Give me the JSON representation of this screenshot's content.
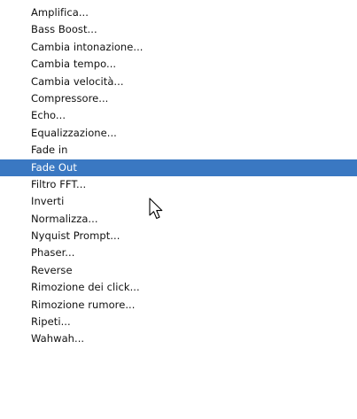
{
  "menu": {
    "items": [
      {
        "label": "Amplifica..."
      },
      {
        "label": "Bass Boost..."
      },
      {
        "label": "Cambia intonazione..."
      },
      {
        "label": "Cambia tempo..."
      },
      {
        "label": "Cambia velocità..."
      },
      {
        "label": "Compressore..."
      },
      {
        "label": "Echo..."
      },
      {
        "label": "Equalizzazione..."
      },
      {
        "label": "Fade in"
      },
      {
        "label": "Fade Out",
        "selected": true
      },
      {
        "label": "Filtro FFT..."
      },
      {
        "label": "Inverti"
      },
      {
        "label": "Normalizza..."
      },
      {
        "label": "Nyquist Prompt..."
      },
      {
        "label": "Phaser..."
      },
      {
        "label": "Reverse"
      },
      {
        "label": "Rimozione dei click..."
      },
      {
        "label": "Rimozione rumore..."
      },
      {
        "label": "Ripeti..."
      },
      {
        "label": "Wahwah..."
      }
    ],
    "selected_color": "#3a78c2",
    "cursor_icon": "arrow-pointer-icon"
  }
}
